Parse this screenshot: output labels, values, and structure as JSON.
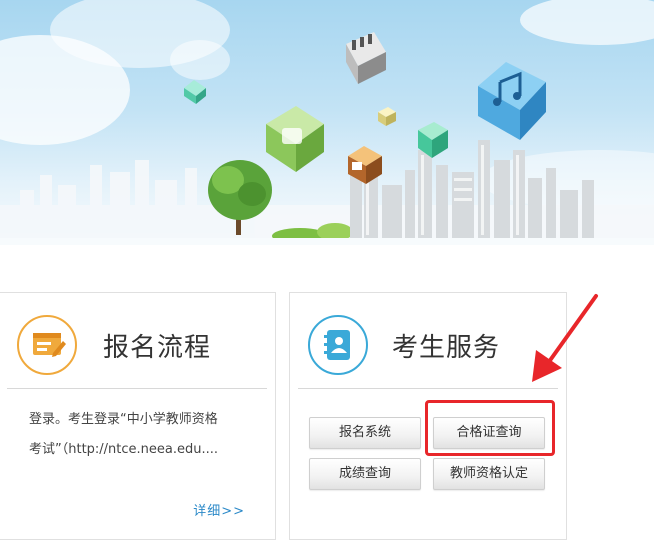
{
  "banner": {
    "accent_sky": "#a7d6f0",
    "icons": [
      "calculator-cube-icon",
      "music-note-cube-icon",
      "folder-cube-icon",
      "swirl-cube-icon",
      "calendar-cube-icon",
      "dot-cube-icon"
    ]
  },
  "registration_card": {
    "title": "报名流程",
    "icon": "form-edit-icon",
    "line1": "登录。考生登录“中小学教师资格",
    "line2": "考试”（http://ntce.neea.edu....",
    "detail_link": "详细>>"
  },
  "service_card": {
    "title": "考生服务",
    "icon": "contact-book-icon",
    "buttons": [
      "报名系统",
      "合格证查询",
      "成绩查询",
      "教师资格认定"
    ]
  },
  "annotation": {
    "highlight_color": "#e8262a",
    "highlighted_button": "合格证查询"
  }
}
